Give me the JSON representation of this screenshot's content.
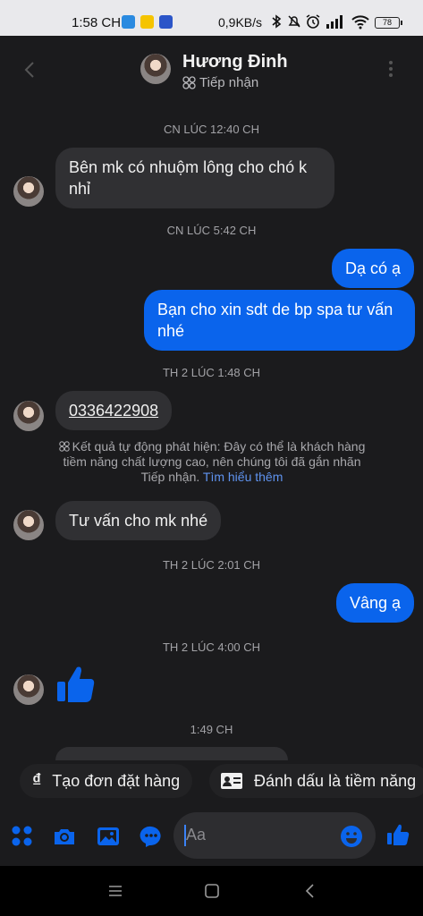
{
  "status_bar": {
    "time": "1:58 CH",
    "network_speed": "0,9KB/s",
    "battery": "78"
  },
  "header": {
    "contact_name": "Hương Đinh",
    "contact_status": "Tiếp nhận"
  },
  "messages": {
    "ts1": "CN LÚC 12:40 CH",
    "m1": "Bên mk có nhuộm lông cho chó k nhỉ",
    "ts2": "CN LÚC 5:42 CH",
    "m2": "Dạ có ạ",
    "m3": "Bạn cho xin sdt de bp spa tư vấn nhé",
    "ts3": "TH 2 LÚC 1:48 CH",
    "m4": "0336422908",
    "notice_text": "Kết quả tự động phát hiện: Đây có thể là khách hàng tiềm năng chất lượng cao, nên chúng tôi đã gắn nhãn Tiếp nhận.",
    "notice_link": "Tìm hiểu thêm",
    "m5": "Tư vấn cho mk nhé",
    "ts4": "TH 2 LÚC 2:01 CH",
    "m6": "Vâng ạ",
    "ts5": "TH 2 LÚC 4:00 CH",
    "ts6": "1:49 CH"
  },
  "quick_actions": {
    "create_order": "Tạo đơn đặt hàng",
    "mark_lead": "Đánh dấu là tiềm năng"
  },
  "composer": {
    "placeholder": "Aa"
  },
  "colors": {
    "accent": "#0a64ec",
    "background": "#1b1b1d",
    "incoming_bubble": "#303033"
  }
}
